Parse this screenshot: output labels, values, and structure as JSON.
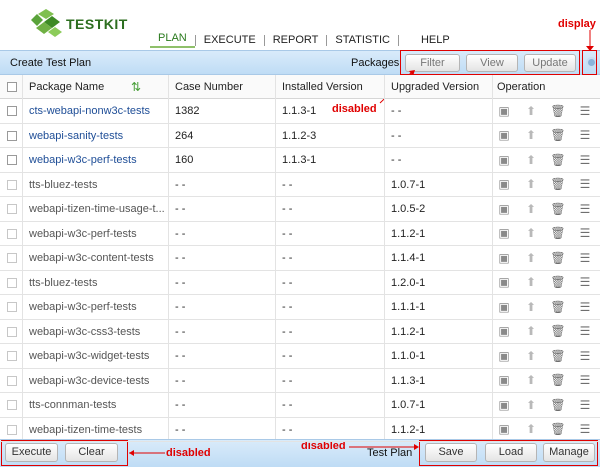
{
  "app": {
    "name": "TESTKIT"
  },
  "nav": {
    "items": [
      "PLAN",
      "EXECUTE",
      "REPORT",
      "STATISTIC",
      "HELP"
    ],
    "active": "PLAN"
  },
  "subbar": {
    "create_label": "Create Test Plan",
    "packages_label": "Packages",
    "filter_label": "Filter",
    "view_label": "View",
    "update_label": "Update"
  },
  "annotations": {
    "display": "display",
    "disabled_top": "disabled",
    "disabled_left": "disabled",
    "disabled_right": "disabled"
  },
  "table": {
    "headers": [
      "Package Name",
      "Case Number",
      "Installed Version",
      "Upgraded Version",
      "Operation"
    ],
    "rows": [
      {
        "name": "cts-webapi-nonw3c-tests",
        "cases": "1382",
        "installed": "1.1.3-1",
        "upgraded": "- -",
        "installed_flag": true
      },
      {
        "name": "webapi-sanity-tests",
        "cases": "264",
        "installed": "1.1.2-3",
        "upgraded": "- -",
        "installed_flag": true
      },
      {
        "name": "webapi-w3c-perf-tests",
        "cases": "160",
        "installed": "1.1.3-1",
        "upgraded": "- -",
        "installed_flag": true
      },
      {
        "name": "tts-bluez-tests",
        "cases": "- -",
        "installed": "- -",
        "upgraded": "1.0.7-1",
        "installed_flag": false
      },
      {
        "name": "webapi-tizen-time-usage-t...",
        "cases": "- -",
        "installed": "- -",
        "upgraded": "1.0.5-2",
        "installed_flag": false
      },
      {
        "name": "webapi-w3c-perf-tests",
        "cases": "- -",
        "installed": "- -",
        "upgraded": "1.1.2-1",
        "installed_flag": false
      },
      {
        "name": "webapi-w3c-content-tests",
        "cases": "- -",
        "installed": "- -",
        "upgraded": "1.1.4-1",
        "installed_flag": false
      },
      {
        "name": "tts-bluez-tests",
        "cases": "- -",
        "installed": "- -",
        "upgraded": "1.2.0-1",
        "installed_flag": false
      },
      {
        "name": "webapi-w3c-perf-tests",
        "cases": "- -",
        "installed": "- -",
        "upgraded": "1.1.1-1",
        "installed_flag": false
      },
      {
        "name": "webapi-w3c-css3-tests",
        "cases": "- -",
        "installed": "- -",
        "upgraded": "1.1.2-1",
        "installed_flag": false
      },
      {
        "name": "webapi-w3c-widget-tests",
        "cases": "- -",
        "installed": "- -",
        "upgraded": "1.1.0-1",
        "installed_flag": false
      },
      {
        "name": "webapi-w3c-device-tests",
        "cases": "- -",
        "installed": "- -",
        "upgraded": "1.1.3-1",
        "installed_flag": false
      },
      {
        "name": "tts-connman-tests",
        "cases": "- -",
        "installed": "- -",
        "upgraded": "1.0.7-1",
        "installed_flag": false
      },
      {
        "name": "webapi-tizen-time-tests",
        "cases": "- -",
        "installed": "- -",
        "upgraded": "1.1.2-1",
        "installed_flag": false
      }
    ]
  },
  "footer": {
    "execute_label": "Execute",
    "clear_label": "Clear",
    "test_plan_label": "Test Plan",
    "save_label": "Save",
    "load_label": "Load",
    "manage_label": "Manage"
  },
  "icons": {
    "package": "package-icon",
    "upgrade": "upgrade-arrow-icon",
    "delete": "trash-icon",
    "details": "list-details-icon"
  },
  "colors": {
    "accent": "#2c6e1f",
    "bar": "#c8e1f7",
    "annotation": "#e00000",
    "link": "#1f4e97"
  }
}
